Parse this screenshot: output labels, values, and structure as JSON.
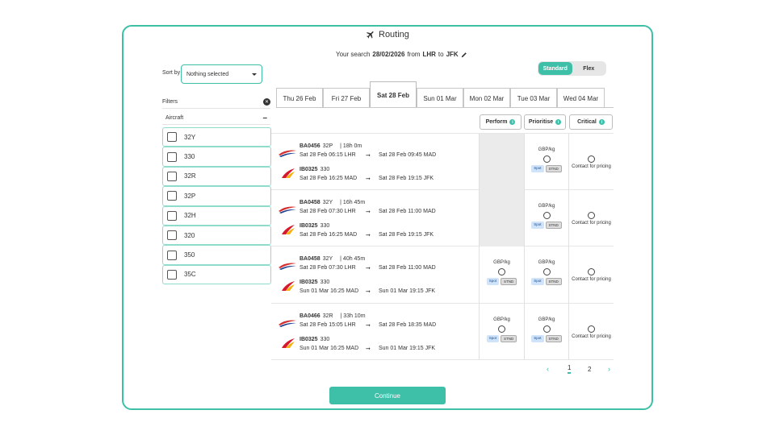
{
  "header": {
    "title": "Routing"
  },
  "search": {
    "prefix": "Your search",
    "date": "28/02/2026",
    "from_label": "from",
    "from": "LHR",
    "to_label": "to",
    "to": "JFK"
  },
  "mode_toggle": {
    "options": [
      "Standard",
      "Flex"
    ],
    "selected": "Standard"
  },
  "sort": {
    "label": "Sort by",
    "value": "Nothing selected"
  },
  "filters": {
    "label": "Filters",
    "aircraft_label": "Aircraft",
    "aircraft": [
      "32Y",
      "330",
      "32R",
      "32P",
      "32H",
      "320",
      "350",
      "35C"
    ]
  },
  "date_tabs": [
    "Thu 26 Feb",
    "Fri 27 Feb",
    "Sat 28 Feb",
    "Sun 01 Mar",
    "Mon 02 Mar",
    "Tue 03 Mar",
    "Wed 04 Mar"
  ],
  "selected_tab": "Sat 28 Feb",
  "columns": [
    "Perform",
    "Prioritise",
    "Critical"
  ],
  "price_unit": "GBP/kg",
  "tag_spot": "Spot",
  "tag_stnd": "STND",
  "contact_text": "Contact for pricing",
  "routes": [
    {
      "leg1": {
        "flight": "BA0456",
        "aircraft": "32P",
        "duration": "| 18h 0m",
        "dep": "Sat 28 Feb 06:15 LHR",
        "arr": "Sat 28 Feb 09:45 MAD"
      },
      "leg2": {
        "flight": "IB0325",
        "aircraft": "330",
        "dep": "Sat 28 Feb 16:25 MAD",
        "arr": "Sat 28 Feb 19:15 JFK"
      },
      "perform_available": false
    },
    {
      "leg1": {
        "flight": "BA0458",
        "aircraft": "32Y",
        "duration": "| 16h 45m",
        "dep": "Sat 28 Feb 07:30 LHR",
        "arr": "Sat 28 Feb 11:00 MAD"
      },
      "leg2": {
        "flight": "IB0325",
        "aircraft": "330",
        "dep": "Sat 28 Feb 16:25 MAD",
        "arr": "Sat 28 Feb 19:15 JFK"
      },
      "perform_available": false
    },
    {
      "leg1": {
        "flight": "BA0458",
        "aircraft": "32Y",
        "duration": "| 40h 45m",
        "dep": "Sat 28 Feb 07:30 LHR",
        "arr": "Sat 28 Feb 11:00 MAD"
      },
      "leg2": {
        "flight": "IB0325",
        "aircraft": "330",
        "dep": "Sun 01 Mar 16:25 MAD",
        "arr": "Sun 01 Mar 19:15 JFK"
      },
      "perform_available": true
    },
    {
      "leg1": {
        "flight": "BA0466",
        "aircraft": "32R",
        "duration": "| 33h 10m",
        "dep": "Sat 28 Feb 15:05 LHR",
        "arr": "Sat 28 Feb 18:35 MAD"
      },
      "leg2": {
        "flight": "IB0325",
        "aircraft": "330",
        "dep": "Sun 01 Mar 16:25 MAD",
        "arr": "Sun 01 Mar 19:15 JFK"
      },
      "perform_available": true
    }
  ],
  "pagination": {
    "pages": [
      "1",
      "2"
    ],
    "current": "1"
  },
  "footer": {
    "continue_label": "Continue"
  },
  "colors": {
    "accent": "#3dbfa8",
    "ba_blue": "#1d3f8f",
    "ba_red": "#d42e2e",
    "iberia_red": "#d7192d",
    "iberia_yellow": "#f6b00f"
  }
}
